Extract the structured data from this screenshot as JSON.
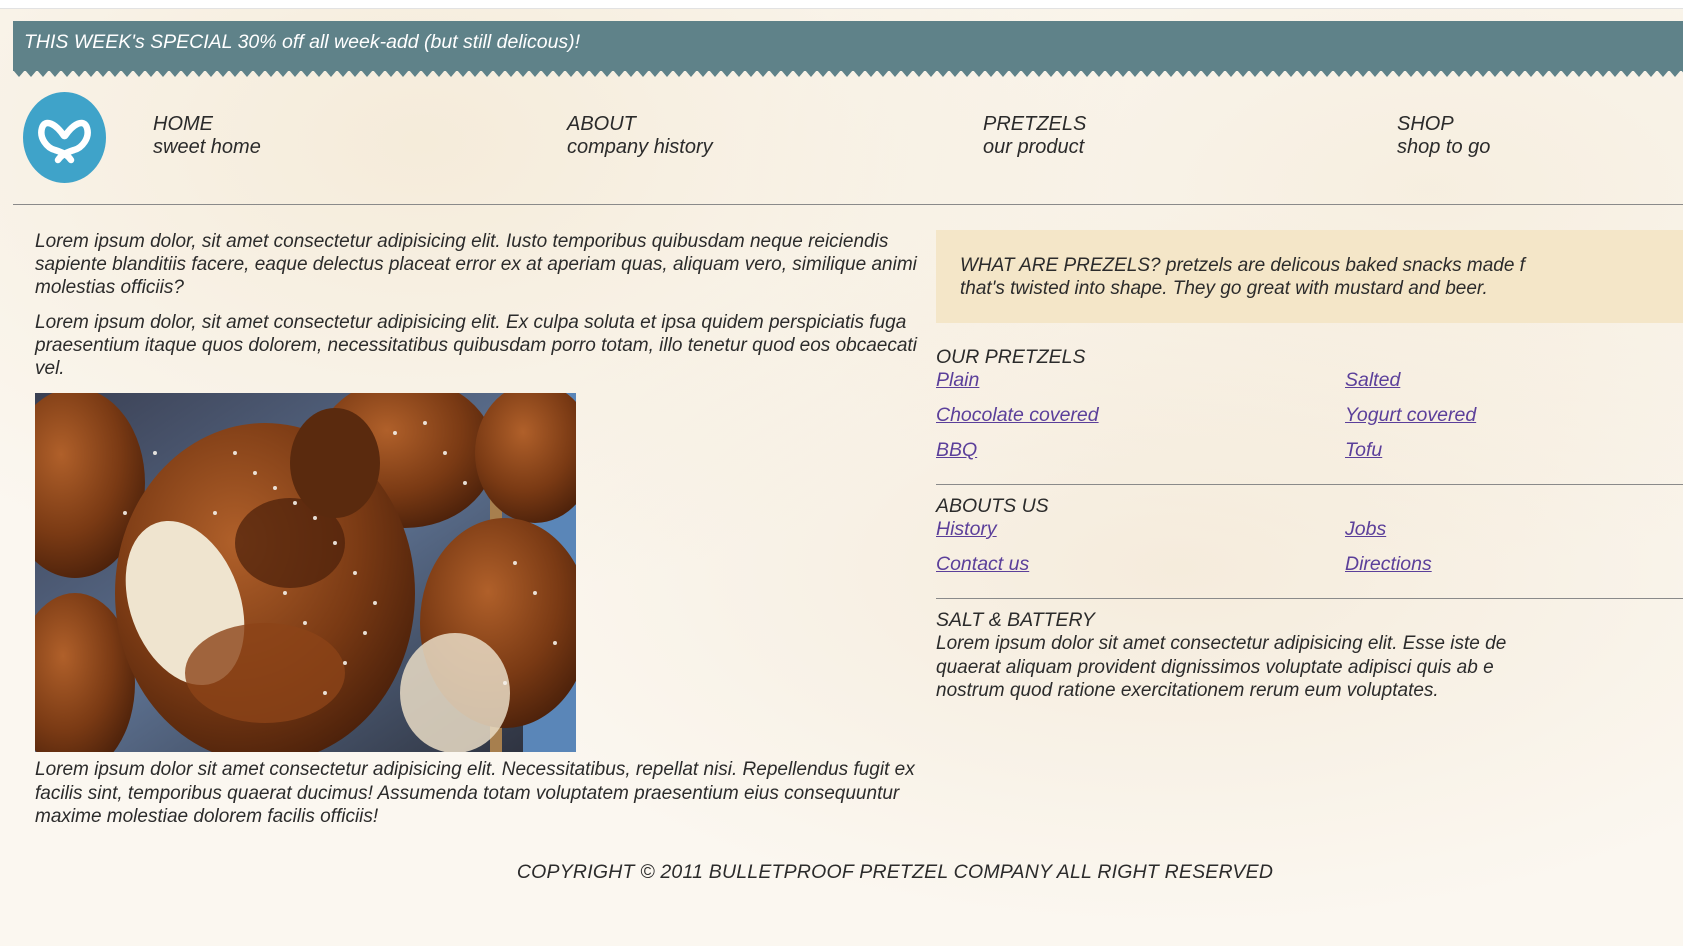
{
  "banner": {
    "text": "THIS WEEK's SPECIAL 30% off all week-add (but still delicous)!"
  },
  "header": {
    "logo_icon": "pretzel-icon",
    "nav": [
      {
        "title": "HOME",
        "subtitle": "sweet home"
      },
      {
        "title": "ABOUT",
        "subtitle": "company history"
      },
      {
        "title": "PRETZELS",
        "subtitle": "our product"
      },
      {
        "title": "SHOP",
        "subtitle": "shop to go"
      }
    ]
  },
  "main": {
    "paragraphs": [
      "Lorem ipsum dolor, sit amet consectetur adipisicing elit. Iusto temporibus quibusdam neque reiciendis sapiente blanditiis facere, eaque delectus placeat error ex at aperiam quas, aliquam vero, similique animi molestias officiis?",
      "Lorem ipsum dolor, sit amet consectetur adipisicing elit. Ex culpa soluta et ipsa quidem perspiciatis fuga praesentium itaque quos dolorem, necessitatibus quibusdam porro totam, illo tenetur quod eos obcaecati vel."
    ],
    "caption": "Lorem ipsum dolor sit amet consectetur adipisicing elit. Necessitatibus, repellat nisi. Repellendus fugit ex facilis sint, temporibus quaerat ducimus! Assumenda totam voluptatem praesentium eius consequuntur maxime molestiae dolorem facilis officiis!"
  },
  "sidebar": {
    "callout_line1": "WHAT ARE PREZELS? pretzels are delicous baked snacks made f",
    "callout_line2": "that's twisted into shape. They go great with mustard and beer.",
    "pretzels_title": "OUR PRETZELS",
    "pretzels": [
      "Plain",
      "Salted",
      "Chocolate covered",
      "Yogurt covered",
      "BBQ",
      "Tofu"
    ],
    "about_title": "ABOUTS US",
    "about_links": [
      "History",
      "Jobs",
      "Contact us",
      "Directions"
    ],
    "salt_title": "SALT & BATTERY",
    "salt_lines": [
      "Lorem ipsum dolor sit amet consectetur adipisicing elit. Esse iste de",
      "quaerat aliquam provident dignissimos voluptate adipisci quis ab e",
      "nostrum quod ratione exercitationem rerum eum voluptates."
    ]
  },
  "footer": {
    "text": "COPYRIGHT © 2011 BULLETPROOF PRETZEL COMPANY ALL RIGHT RESERVED"
  },
  "colors": {
    "banner": "#5f8289",
    "callout": "#f4e6c8",
    "logo": "#3fa3c9",
    "link": "#5b3f9a"
  }
}
